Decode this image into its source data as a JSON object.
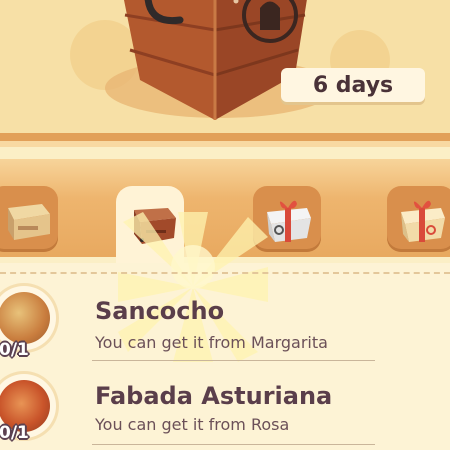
{
  "timer": {
    "text": "6 days"
  },
  "tabs": [
    {
      "name": "tab-crate-plain"
    },
    {
      "name": "tab-crate-wood",
      "selected": true
    },
    {
      "name": "tab-gift-box-white"
    },
    {
      "name": "tab-gift-box-cream"
    }
  ],
  "recipes": [
    {
      "name": "Sancocho",
      "source": "You can get it from Margarita",
      "count": "0/1"
    },
    {
      "name": "Fabada Asturiana",
      "source": "You can get it from Rosa",
      "count": "0/1"
    }
  ],
  "colors": {
    "accent": "#e8a960",
    "text": "#5a3e4a",
    "panel": "#fdf3d5"
  }
}
